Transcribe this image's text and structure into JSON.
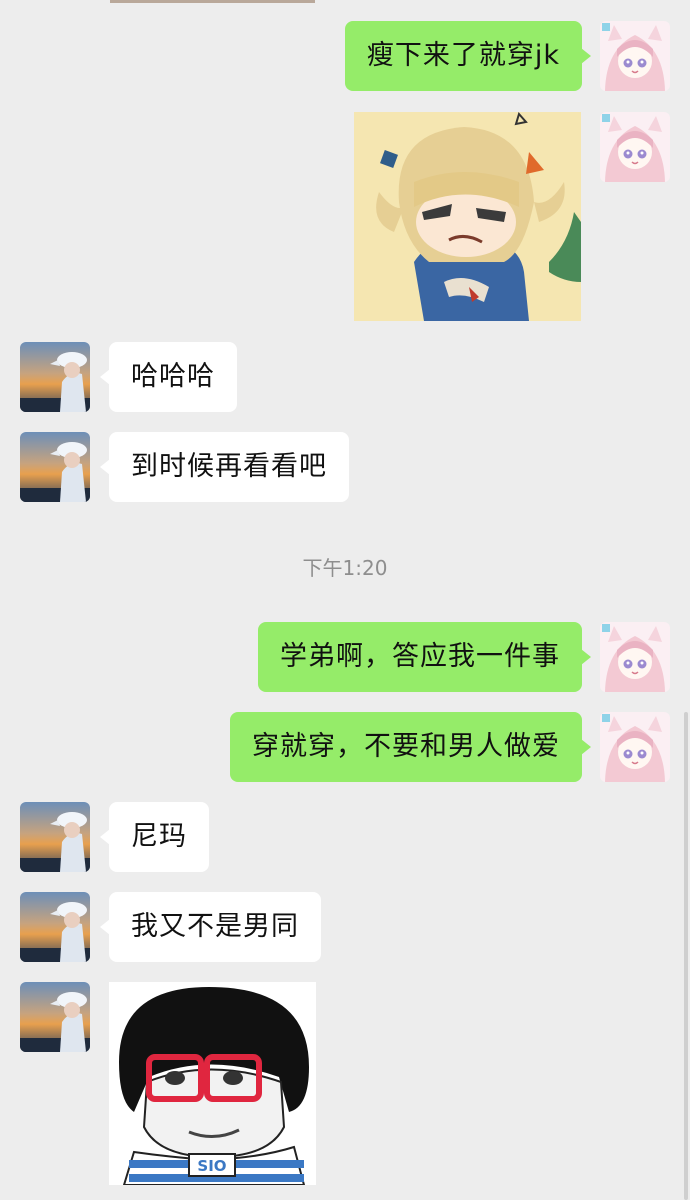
{
  "chat": {
    "timestamp": "下午1:20",
    "messages": [
      {
        "side": "right",
        "text": "瘦下来了就穿jk"
      },
      {
        "side": "right",
        "type": "sticker",
        "sticker": "blonde-anime-girl-smirk"
      },
      {
        "side": "left",
        "text": "哈哈哈"
      },
      {
        "side": "left",
        "text": "到时候再看看吧"
      },
      {
        "side": "right",
        "text": "学弟啊，答应我一件事"
      },
      {
        "side": "right",
        "text": "穿就穿，不要和男人做爱"
      },
      {
        "side": "left",
        "text": "尼玛"
      },
      {
        "side": "left",
        "text": "我又不是男同"
      },
      {
        "side": "left",
        "type": "sticker",
        "sticker": "bowl-cut-glasses-meme",
        "caption": "SIO"
      }
    ]
  },
  "colors": {
    "background": "#ededed",
    "sent_bubble": "#95ec69",
    "received_bubble": "#ffffff",
    "timestamp_text": "#8e8e8e"
  }
}
